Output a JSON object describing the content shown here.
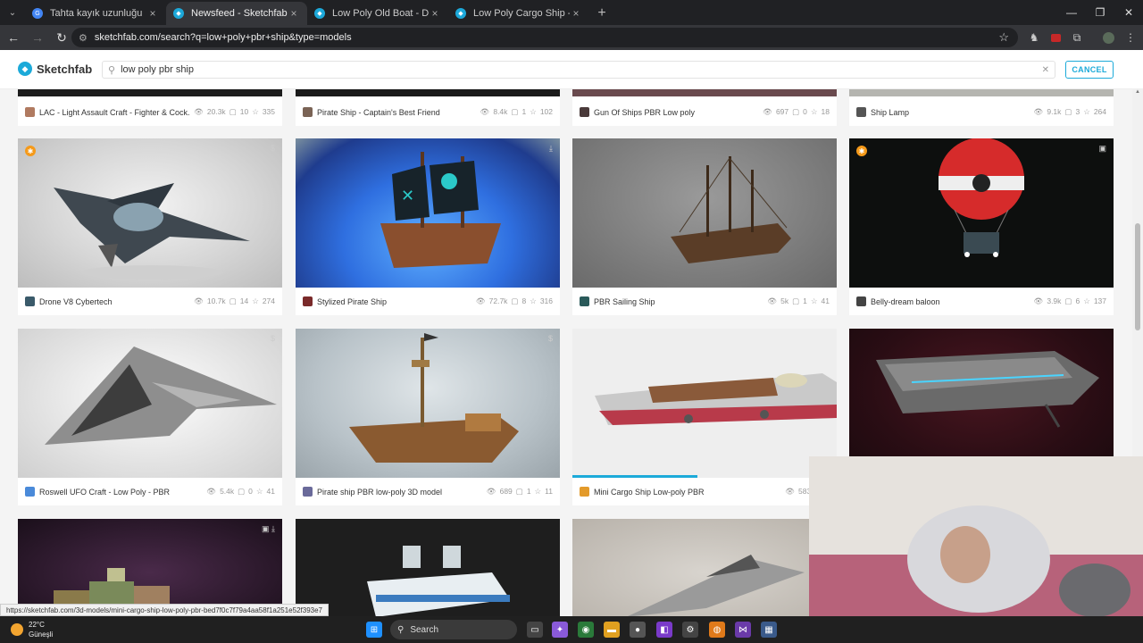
{
  "browser": {
    "tabs": [
      {
        "title": "Tahta kayık uzunluğu",
        "active": false
      },
      {
        "title": "Newsfeed - Sketchfab",
        "active": true
      },
      {
        "title": "Low Poly Old Boat - Download",
        "active": false
      },
      {
        "title": "Low Poly Cargo Ship - Downlo",
        "active": false
      }
    ],
    "url": "sketchfab.com/search?q=low+poly+pbr+ship&type=models"
  },
  "header": {
    "logo": "Sketchfab",
    "search_value": "low poly pbr ship",
    "cancel_label": "CANCEL"
  },
  "cards": [
    {
      "title": "LAC - Light Assault Craft - Fighter & Cock...",
      "views": "20.3k",
      "comments": "10",
      "likes": "335"
    },
    {
      "title": "Pirate Ship - Captain's Best Friend",
      "views": "8.4k",
      "comments": "1",
      "likes": "102"
    },
    {
      "title": "Gun Of Ships PBR Low poly",
      "views": "697",
      "comments": "0",
      "likes": "18"
    },
    {
      "title": "Ship Lamp",
      "views": "9.1k",
      "comments": "3",
      "likes": "264"
    },
    {
      "title": "Drone V8 Cybertech",
      "views": "10.7k",
      "comments": "14",
      "likes": "274"
    },
    {
      "title": "Stylized Pirate Ship",
      "views": "72.7k",
      "comments": "8",
      "likes": "316"
    },
    {
      "title": "PBR Sailing Ship",
      "views": "5k",
      "comments": "1",
      "likes": "41"
    },
    {
      "title": "Belly-dream baloon",
      "views": "3.9k",
      "comments": "6",
      "likes": "137"
    },
    {
      "title": "Roswell UFO Craft - Low Poly - PBR",
      "views": "5.4k",
      "comments": "0",
      "likes": "41"
    },
    {
      "title": "Pirate ship PBR low-poly 3D model",
      "views": "689",
      "comments": "1",
      "likes": "11"
    },
    {
      "title": "Mini Cargo Ship Low-poly PBR",
      "views": "583",
      "comments": "0",
      "likes": ""
    }
  ],
  "status_url": "https://sketchfab.com/3d-models/mini-cargo-ship-low-poly-pbr-bed7f0c7f79a4aa58f1a251e52f393e7",
  "taskbar": {
    "temperature": "22°C",
    "weather": "Güneşli",
    "search_label": "Search"
  }
}
